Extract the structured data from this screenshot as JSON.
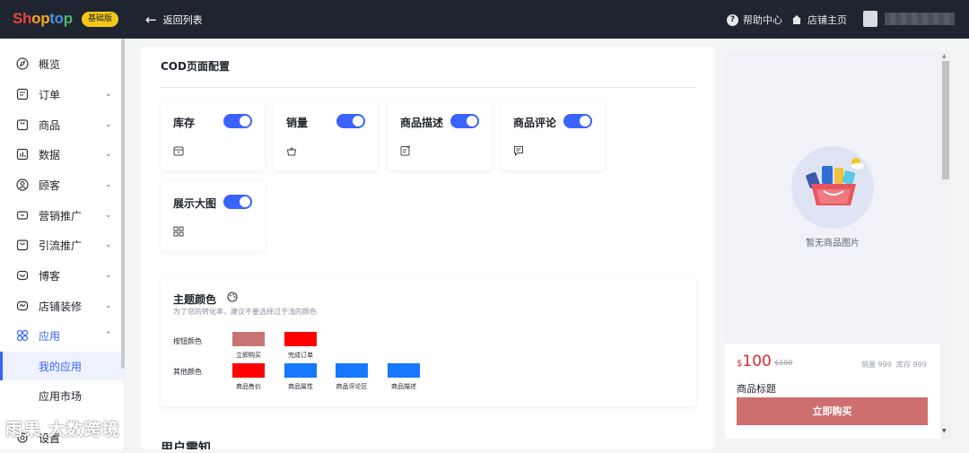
{
  "app": {
    "logo": {
      "part1": "Sh",
      "part2": "op",
      "part3": "to",
      "part4": "p"
    },
    "plan_badge": "基础版"
  },
  "header": {
    "back_label": "返回列表",
    "help_label": "帮助中心",
    "store_label": "店铺主页"
  },
  "sidebar": {
    "items": [
      {
        "label": "概览",
        "icon": "compass-icon"
      },
      {
        "label": "订单",
        "icon": "order-icon",
        "chevron": "⌄"
      },
      {
        "label": "商品",
        "icon": "product-icon",
        "chevron": "⌄"
      },
      {
        "label": "数据",
        "icon": "chart-icon",
        "chevron": "⌄"
      },
      {
        "label": "顾客",
        "icon": "user-icon",
        "chevron": "⌄"
      },
      {
        "label": "营销推广",
        "icon": "marketing-icon",
        "chevron": "⌄"
      },
      {
        "label": "引流推广",
        "icon": "traffic-icon",
        "chevron": "⌄"
      },
      {
        "label": "博客",
        "icon": "blog-icon",
        "chevron": "⌄"
      },
      {
        "label": "店铺装修",
        "icon": "design-icon",
        "chevron": "⌄"
      },
      {
        "label": "应用",
        "icon": "apps-icon",
        "chevron": "⌃"
      }
    ],
    "sub_items": [
      "我的应用",
      "应用市场"
    ],
    "next_item": "设置",
    "watermark": "雨果 大数跨境"
  },
  "main": {
    "section_title": "COD页面配置",
    "toggles": [
      {
        "label": "库存",
        "on": true,
        "icon": "inventory-icon"
      },
      {
        "label": "销量",
        "on": true,
        "icon": "basket-icon"
      },
      {
        "label": "商品描述",
        "on": true,
        "icon": "edit-icon"
      },
      {
        "label": "商品评论",
        "on": true,
        "icon": "comment-icon"
      },
      {
        "label": "展示大图",
        "on": true,
        "icon": "grid-icon"
      }
    ],
    "theme": {
      "title": "主题颜色",
      "desc": "为了您的转化率，建议不要选择过于浅的颜色",
      "button_row_label": "按钮颜色",
      "other_row_label": "其他颜色",
      "button_colors": [
        {
          "label": "立即购买",
          "color": "#c97474"
        },
        {
          "label": "完成订单",
          "color": "#ff0000"
        }
      ],
      "other_colors": [
        {
          "label": "商品售价",
          "color": "#ff0000"
        },
        {
          "label": "商品属性",
          "color": "#1677ff"
        },
        {
          "label": "商品评论区",
          "color": "#1677ff"
        },
        {
          "label": "商品描述",
          "color": "#1677ff"
        }
      ]
    },
    "next_section_title": "用户需知"
  },
  "preview": {
    "no_image_text": "暂无商品图片",
    "currency": "$",
    "price": "100",
    "old_price": "$100",
    "sales": "销量 999",
    "stock": "库存 999",
    "product_title": "商品标题",
    "buy_label": "立即购买"
  },
  "colors": {
    "accent": "#3a63ff",
    "topbar": "#1e2530",
    "buy_button": "#cf6e6e",
    "price": "#e0262f"
  }
}
